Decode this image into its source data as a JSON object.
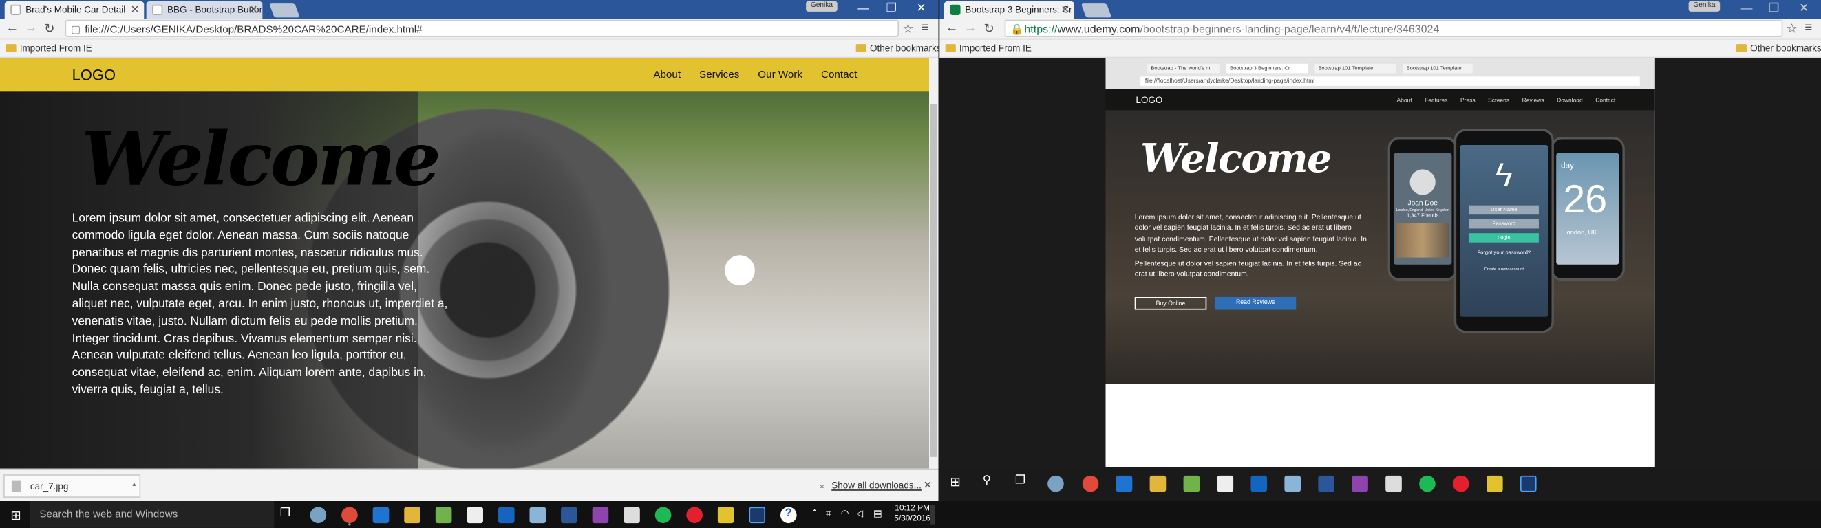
{
  "left_window": {
    "tabs": [
      {
        "title": "Brad's Mobile Car Detail",
        "active": true
      },
      {
        "title": "BBG - Bootstrap Button G",
        "active": false
      }
    ],
    "user_badge": "Genika",
    "url": "file:///C:/Users/GENIKA/Desktop/BRADS%20CAR%20CARE/index.html#",
    "bookmarks": {
      "imported": "Imported From IE",
      "other": "Other bookmarks"
    },
    "page": {
      "logo": "LOGO",
      "nav": [
        "About",
        "Services",
        "Our Work",
        "Contact"
      ],
      "heading": "Welcome",
      "paragraph": "Lorem ipsum dolor sit amet, consectetuer adipiscing elit. Aenean commodo ligula eget dolor. Aenean massa. Cum sociis natoque penatibus et magnis dis parturient montes, nascetur ridiculus mus. Donec quam felis, ultricies nec, pellentesque eu, pretium quis, sem. Nulla consequat massa quis enim. Donec pede justo, fringilla vel, aliquet nec, vulputate eget, arcu. In enim justo, rhoncus ut, imperdiet a, venenatis vitae, justo. Nullam dictum felis eu pede mollis pretium. Integer tincidunt. Cras dapibus. Vivamus elementum semper nisi. Aenean vulputate eleifend tellus. Aenean leo ligula, porttitor eu, consequat vitae, eleifend ac, enim. Aliquam lorem ante, dapibus in, viverra quis, feugiat a, tellus."
    },
    "download": {
      "file": "car_7.jpg",
      "show_all": "Show all downloads..."
    }
  },
  "right_window": {
    "tabs": [
      {
        "title": "Bootstrap 3 Beginners: Cr",
        "active": true
      }
    ],
    "user_badge": "Genika",
    "url_scheme": "https://",
    "url_host": "www.udemy.com",
    "url_path": "/bootstrap-beginners-landing-page/learn/v4/t/lecture/3463024",
    "bookmarks": {
      "imported": "Imported From IE",
      "other": "Other bookmarks"
    },
    "video": {
      "tabs": [
        "Bootstrap - The world's m",
        "Bootstrap 3 Beginners: Cr",
        "Bootstrap 101 Template",
        "Bootstrap 101 Template"
      ],
      "url": "file:///localhost/Users/andyclarke/Desktop/landing-page/index.html",
      "logo": "LOGO",
      "nav": [
        "About",
        "Features",
        "Press",
        "Screens",
        "Reviews",
        "Download",
        "Contact"
      ],
      "heading": "Welcome",
      "paragraph1": "Lorem ipsum dolor sit amet, consectetur adipiscing elit. Pellentesque ut dolor vel sapien feugiat lacinia. In et felis turpis. Sed ac erat ut libero volutpat condimentum. Pellentesque ut dolor vel sapien feugiat lacinia. In et felis turpis. Sed ac erat ut libero volutpat condimentum.",
      "paragraph2": "Pellentesque ut dolor vel sapien feugiat lacinia. In et felis turpis. Sed ac erat ut libero volutpat condimentum.",
      "buy_button": "Buy Online",
      "reviews_button": "Read Reviews",
      "phone_left": {
        "name": "Joan Doe",
        "location": "London, England, United Kingdom",
        "friends": "1,347 Friends"
      },
      "phone_center": {
        "username": "User Name",
        "password": "Password",
        "login": "Login",
        "forgot": "Forgot your password?",
        "create": "Create a new account"
      },
      "phone_right": {
        "day": "day",
        "temp": "26",
        "city": "London, UK"
      }
    }
  },
  "taskbar": {
    "search_placeholder": "Search the web and Windows",
    "time": "10:12 PM",
    "date": "5/30/2016"
  },
  "colors": {
    "nav_yellow": "#e2c32f",
    "udemy_green": "#0b8043",
    "read_reviews_blue": "#2e6fb8",
    "login_teal": "#3cc1a0"
  }
}
